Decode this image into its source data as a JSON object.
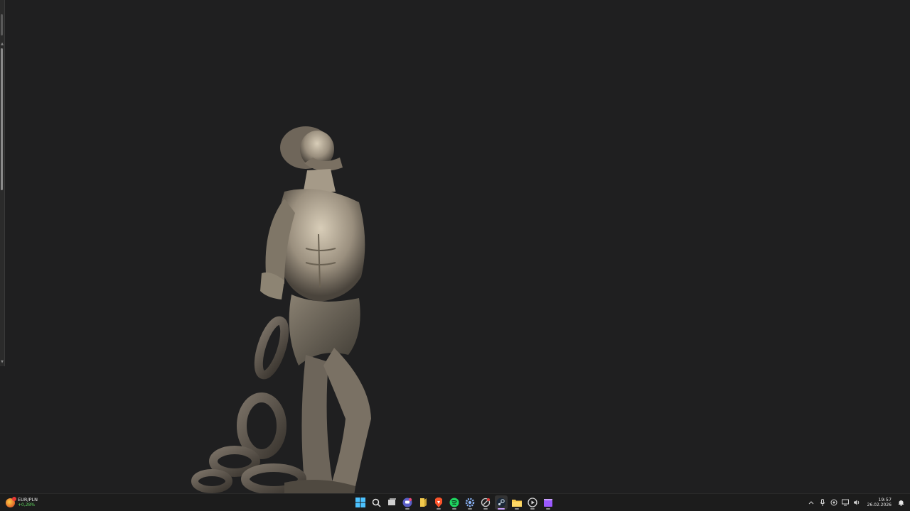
{
  "desktop": {
    "wallpaper_icon": "statue-wallpaper"
  },
  "taskbar": {
    "widget": {
      "pair": "EUR/PLN",
      "change": "+0,28%",
      "change_color": "#5fd35f"
    },
    "apps": [
      {
        "name": "start-button",
        "icon": "windows-icon"
      },
      {
        "name": "search-button",
        "icon": "search-icon"
      },
      {
        "name": "task-view-button",
        "icon": "task-view-icon"
      },
      {
        "name": "chat-app",
        "icon": "chat-icon"
      },
      {
        "name": "notes-app",
        "icon": "notes-icon"
      },
      {
        "name": "brave-browser",
        "icon": "brave-icon"
      },
      {
        "name": "spotify-app",
        "icon": "spotify-icon"
      },
      {
        "name": "settings-app",
        "icon": "gear-icon"
      },
      {
        "name": "app-9",
        "icon": "circle-app-icon"
      },
      {
        "name": "steam-app",
        "icon": "steam-icon",
        "active": true
      },
      {
        "name": "file-explorer",
        "icon": "folder-icon"
      },
      {
        "name": "media-player",
        "icon": "play-icon"
      },
      {
        "name": "video-app",
        "icon": "clapper-icon"
      }
    ],
    "tray": {
      "time": "19:57",
      "date": "26.02.2026"
    }
  },
  "colors": {
    "desktop_bg": "#1f1f20",
    "taskbar_bg": "#1c1c1c",
    "accent_active": "#c9a0ff"
  }
}
